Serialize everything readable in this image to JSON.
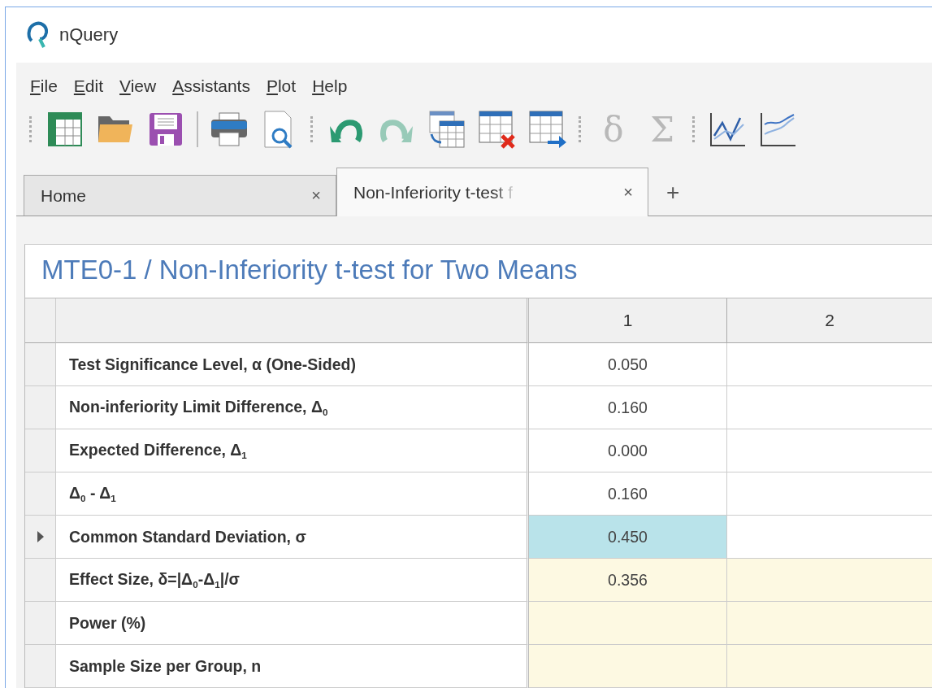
{
  "window": {
    "title": "nQuery"
  },
  "menu": [
    "File",
    "Edit",
    "View",
    "Assistants",
    "Plot",
    "Help"
  ],
  "toolbar": [
    {
      "kind": "grip"
    },
    {
      "kind": "new-sheet",
      "disabled": false
    },
    {
      "kind": "open",
      "disabled": false
    },
    {
      "kind": "save",
      "disabled": false
    },
    {
      "kind": "separator"
    },
    {
      "kind": "print",
      "disabled": false
    },
    {
      "kind": "preview",
      "disabled": false
    },
    {
      "kind": "grip"
    },
    {
      "kind": "undo",
      "disabled": false
    },
    {
      "kind": "redo",
      "disabled": true
    },
    {
      "kind": "insert-rows",
      "disabled": false
    },
    {
      "kind": "delete-column",
      "disabled": false
    },
    {
      "kind": "append-column",
      "disabled": false
    },
    {
      "kind": "grip"
    },
    {
      "kind": "glyph",
      "label": "δ",
      "disabled": true
    },
    {
      "kind": "glyph",
      "label": "Σ",
      "disabled": true
    },
    {
      "kind": "grip"
    },
    {
      "kind": "line-plot",
      "disabled": false
    },
    {
      "kind": "area-plot",
      "disabled": false
    }
  ],
  "tabs": [
    {
      "label": "Home",
      "selected": false,
      "close": "×"
    },
    {
      "label": "Non-Inferiority t-test f",
      "selected": true,
      "close": "×"
    }
  ],
  "new_tab": "+",
  "document": {
    "title": "MTE0-1 / Non-Inferiority t-test for Two Means",
    "columns": [
      "1",
      "2"
    ],
    "rows": [
      {
        "label": "Test Significance Level, α (One-Sided)",
        "current": false,
        "cells": [
          {
            "value": "0.050",
            "kind": "input",
            "selected": false
          },
          {
            "kind": "input",
            "selected": false
          }
        ]
      },
      {
        "label": "Non-inferiority Limit Difference, Δ$_{0}$",
        "current": false,
        "cells": [
          {
            "value": "0.160",
            "kind": "input",
            "selected": false
          },
          {
            "kind": "input",
            "selected": false
          }
        ]
      },
      {
        "label": "Expected Difference, Δ$_{1}$",
        "current": false,
        "cells": [
          {
            "value": "0.000",
            "kind": "input",
            "selected": false
          },
          {
            "kind": "input",
            "selected": false
          }
        ]
      },
      {
        "label": "Δ$_{0}$ - Δ$_{1}$",
        "current": false,
        "cells": [
          {
            "value": "0.160",
            "kind": "input",
            "selected": false
          },
          {
            "kind": "input",
            "selected": false
          }
        ]
      },
      {
        "label": "Common Standard Deviation, σ",
        "current": true,
        "cells": [
          {
            "value": "0.450",
            "kind": "input",
            "selected": true
          },
          {
            "kind": "input",
            "selected": false
          }
        ]
      },
      {
        "label": "Effect Size, δ=|Δ$_{0}$-Δ$_{1}$|/σ",
        "current": false,
        "cells": [
          {
            "value": "0.356",
            "kind": "output",
            "selected": false
          },
          {
            "kind": "output",
            "selected": false
          }
        ]
      },
      {
        "label": "Power (%)",
        "current": false,
        "cells": [
          {
            "kind": "output",
            "selected": false
          },
          {
            "kind": "output",
            "selected": false
          }
        ]
      },
      {
        "label": "Sample Size per Group, n",
        "current": false,
        "cells": [
          {
            "kind": "output",
            "selected": false
          },
          {
            "kind": "output",
            "selected": false
          }
        ]
      }
    ]
  }
}
